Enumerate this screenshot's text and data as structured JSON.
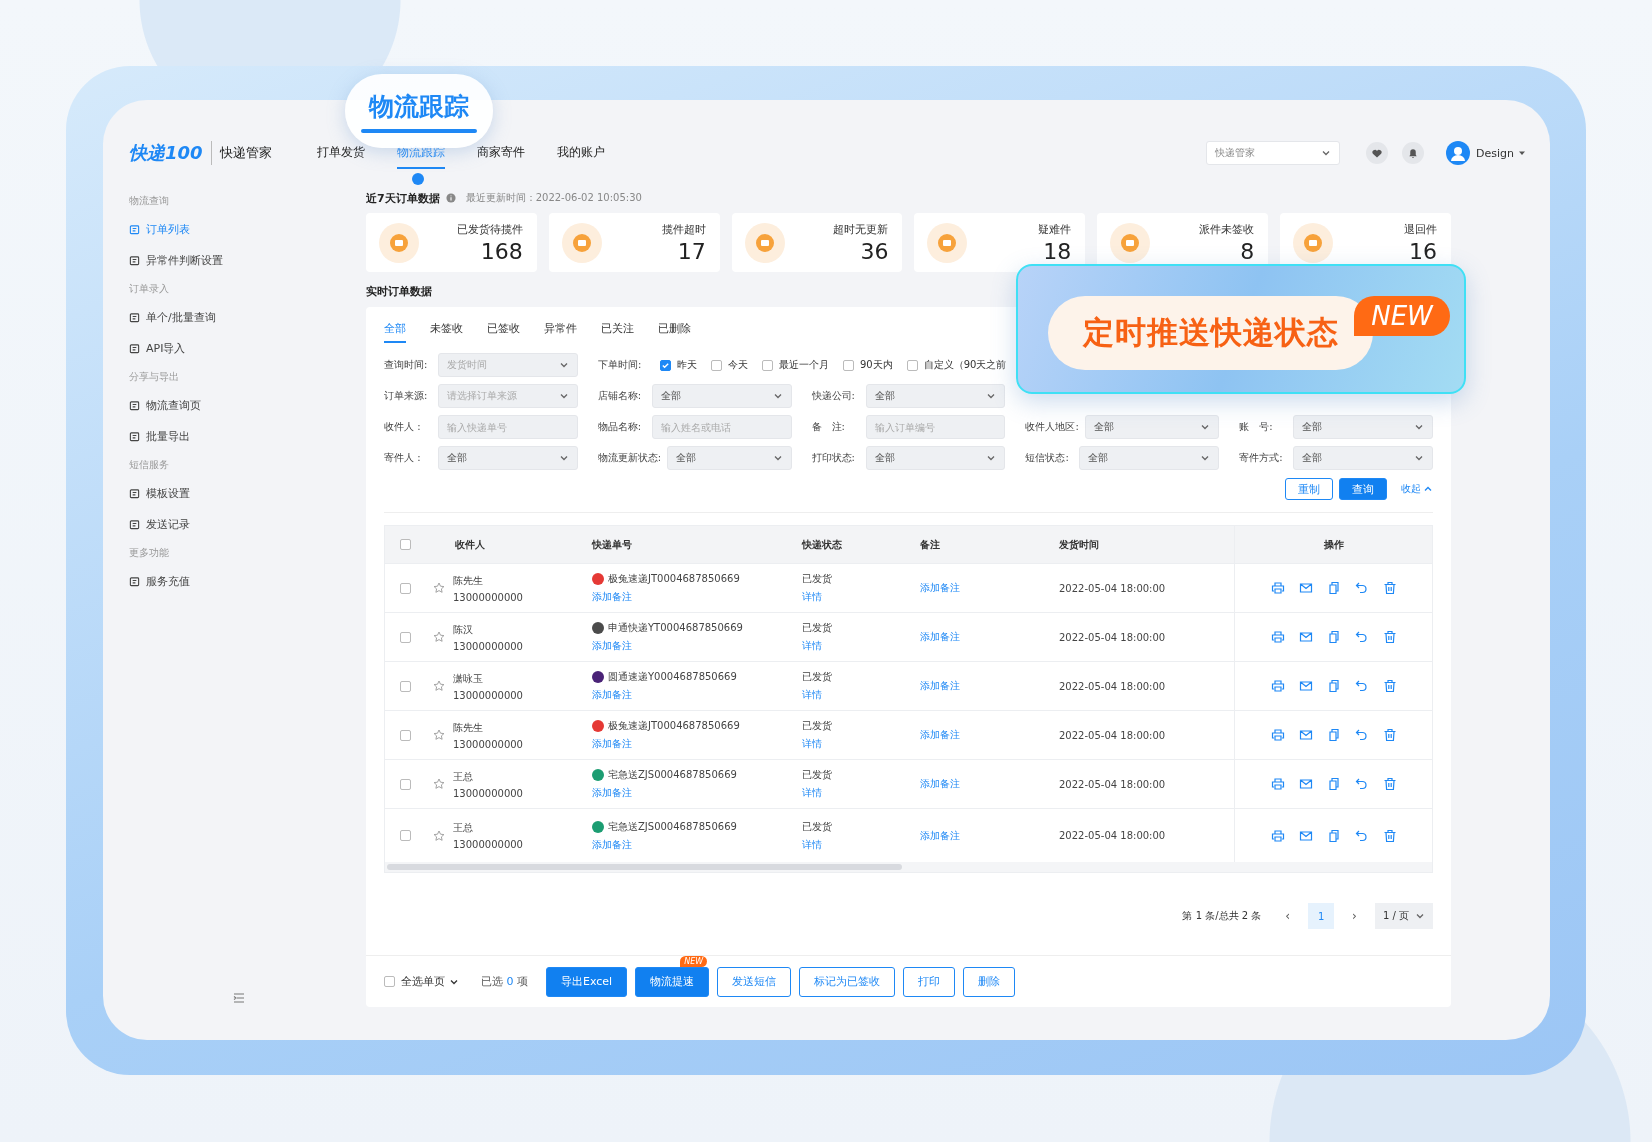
{
  "callout": {
    "label": "物流跟踪"
  },
  "feature_callout": {
    "label": "定时推送快递状态",
    "badge": "NEW"
  },
  "header": {
    "logo": "快递100",
    "app_name": "快递管家",
    "nav": [
      {
        "label": "打单发货",
        "selected": false
      },
      {
        "label": "物流跟踪",
        "selected": true
      },
      {
        "label": "商家寄件",
        "selected": false
      },
      {
        "label": "我的账户",
        "selected": false
      }
    ],
    "account_select": "快递管家",
    "user": "Design"
  },
  "sidebar": {
    "groups": [
      {
        "title": "物流查询",
        "items": [
          {
            "label": "订单列表",
            "selected": true
          },
          {
            "label": "异常件判断设置",
            "selected": false
          }
        ]
      },
      {
        "title": "订单录入",
        "items": [
          {
            "label": "单个/批量查询",
            "selected": false
          },
          {
            "label": "API导入",
            "selected": false
          }
        ]
      },
      {
        "title": "分享与导出",
        "items": [
          {
            "label": "物流查询页",
            "selected": false
          },
          {
            "label": "批量导出",
            "selected": false
          }
        ]
      },
      {
        "title": "短信服务",
        "items": [
          {
            "label": "模板设置",
            "selected": false
          },
          {
            "label": "发送记录",
            "selected": false
          }
        ]
      },
      {
        "title": "更多功能",
        "items": [
          {
            "label": "服务充值",
            "selected": false
          }
        ]
      }
    ]
  },
  "summary": {
    "title": "近7天订单数据",
    "updated": "最近更新时间：2022-06-02 10:05:30",
    "cards": [
      {
        "label": "已发货待揽件",
        "value": "168"
      },
      {
        "label": "揽件超时",
        "value": "17"
      },
      {
        "label": "超时无更新",
        "value": "36"
      },
      {
        "label": "疑难件",
        "value": "18"
      },
      {
        "label": "派件未签收",
        "value": "8"
      },
      {
        "label": "退回件",
        "value": "16"
      }
    ]
  },
  "orders": {
    "title": "实时订单数据",
    "tabs": [
      {
        "label": "全部",
        "selected": true
      },
      {
        "label": "未签收",
        "selected": false
      },
      {
        "label": "已签收",
        "selected": false
      },
      {
        "label": "异常件",
        "selected": false
      },
      {
        "label": "已关注",
        "selected": false
      },
      {
        "label": "已删除",
        "selected": false
      }
    ],
    "time_filter": {
      "label": "查询时间:",
      "placeholder": "发货时间"
    },
    "date_filter": {
      "label": "下单时间:",
      "options": [
        {
          "label": "昨天",
          "checked": true
        },
        {
          "label": "今天",
          "checked": false
        },
        {
          "label": "最近一个月",
          "checked": false
        },
        {
          "label": "90天内",
          "checked": false
        },
        {
          "label": "自定义（90天之前",
          "checked": false
        }
      ]
    },
    "filter_rows": [
      [
        {
          "label": "订单来源:",
          "kind": "select",
          "placeholder": "请选择订单来源"
        },
        {
          "label": "店铺名称:",
          "kind": "select",
          "value": "全部"
        },
        {
          "label": "快递公司:",
          "kind": "select",
          "value": "全部"
        }
      ],
      [
        {
          "label": "收件人 :",
          "kind": "input",
          "placeholder": "输入快递单号"
        },
        {
          "label": "物品名称:",
          "kind": "input",
          "placeholder": "输入姓名或电话"
        },
        {
          "label": "备　注:",
          "kind": "input",
          "placeholder": "输入订单编号"
        },
        {
          "label": "收件人地区:",
          "kind": "select",
          "value": "全部"
        },
        {
          "label": "账　号:",
          "kind": "select",
          "value": "全部"
        }
      ],
      [
        {
          "label": "寄件人 :",
          "kind": "select",
          "value": "全部"
        },
        {
          "label": "物流更新状态:",
          "kind": "select",
          "value": "全部"
        },
        {
          "label": "打印状态:",
          "kind": "select",
          "value": "全部"
        },
        {
          "label": "短信状态:",
          "kind": "select",
          "value": "全部"
        },
        {
          "label": "寄件方式:",
          "kind": "select",
          "value": "全部"
        }
      ]
    ],
    "reset_button": "重制",
    "search_button": "查询",
    "collapse_link": "收起",
    "table": {
      "select_all_rows": {
        "checked": false
      },
      "columns": [
        "收件人",
        "快递单号",
        "快递状态",
        "备注",
        "发货时间",
        "操作"
      ],
      "rows": [
        {
          "selected": false,
          "starred": false,
          "name": "陈先生",
          "phone": "13000000000",
          "color": "#e53935",
          "tracking": "极兔速递JT0004687850669",
          "note_link": "添加备注",
          "status": "已发货",
          "detail_link": "详情",
          "remark": "添加备注",
          "time": "2022-05-04 18:00:00"
        },
        {
          "selected": false,
          "starred": false,
          "name": "陈汉",
          "phone": "13000000000",
          "color": "#4b4b4b",
          "tracking": "申通快递YT0004687850669",
          "note_link": "添加备注",
          "status": "已发货",
          "detail_link": "详情",
          "remark": "添加备注",
          "time": "2022-05-04 18:00:00"
        },
        {
          "selected": false,
          "starred": false,
          "name": "潇咏玉",
          "phone": "13000000000",
          "color": "#4a2377",
          "tracking": "圆通速递Y0004687850669",
          "note_link": "添加备注",
          "status": "已发货",
          "detail_link": "详情",
          "remark": "添加备注",
          "time": "2022-05-04 18:00:00"
        },
        {
          "selected": false,
          "starred": false,
          "name": "陈先生",
          "phone": "13000000000",
          "color": "#e53935",
          "tracking": "极兔速递JT0004687850669",
          "note_link": "添加备注",
          "status": "已发货",
          "detail_link": "详情",
          "remark": "添加备注",
          "time": "2022-05-04 18:00:00"
        },
        {
          "selected": false,
          "starred": false,
          "name": "王总",
          "phone": "13000000000",
          "color": "#1c9d72",
          "tracking": "宅急送ZJS0004687850669",
          "note_link": "添加备注",
          "status": "已发货",
          "detail_link": "详情",
          "remark": "添加备注",
          "time": "2022-05-04 18:00:00"
        },
        {
          "selected": false,
          "starred": false,
          "name": "王总",
          "phone": "13000000000",
          "color": "#1c9d72",
          "tracking": "宅急送ZJS0004687850669",
          "note_link": "添加备注",
          "status": "已发货",
          "detail_link": "详情",
          "remark": "添加备注",
          "time": "2022-05-04 18:00:00"
        }
      ]
    },
    "pagination": {
      "summary": "第 1 条/总共 2 条",
      "prev": "‹",
      "pages": [
        {
          "label": "1",
          "selected": true
        }
      ],
      "next": "›",
      "page_size": "1 / 页"
    },
    "bulk_bar": {
      "select_all": {
        "label": "全选单页",
        "checked": false
      },
      "selected_prefix": "已选",
      "selected_count": "0",
      "selected_suffix": "项",
      "buttons": [
        {
          "label": "导出Excel",
          "kind": "primary"
        },
        {
          "label": "物流提速",
          "kind": "primary",
          "badge": "NEW"
        },
        {
          "label": "发送短信",
          "kind": "outline"
        },
        {
          "label": "标记为已签收",
          "kind": "outline"
        },
        {
          "label": "打印",
          "kind": "outline"
        },
        {
          "label": "删除",
          "kind": "outline"
        }
      ]
    }
  }
}
